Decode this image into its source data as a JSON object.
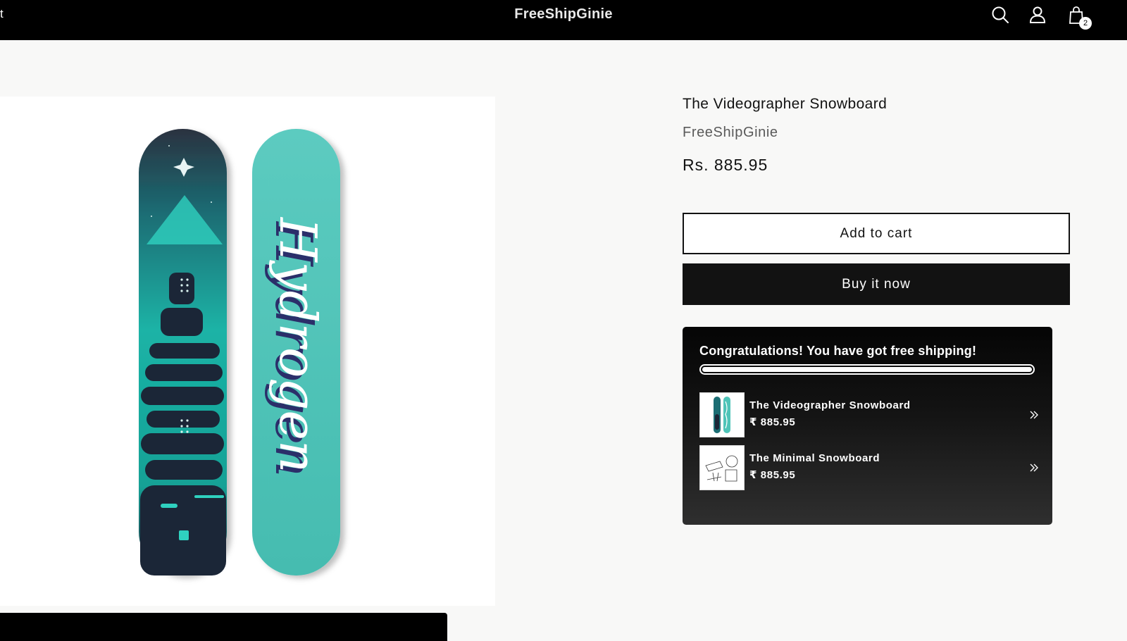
{
  "header": {
    "left_text": "t",
    "brand": "FreeShipGinie",
    "icons": [
      "search-icon",
      "account-icon",
      "cart-icon"
    ],
    "cart_count": "2"
  },
  "product": {
    "title": "The Videographer Snowboard",
    "vendor": "FreeShipGinie",
    "price": "Rs. 885.95",
    "add_to_cart_label": "Add to cart",
    "buy_now_label": "Buy it now",
    "image_text": "Hydrogen"
  },
  "free_shipping": {
    "message": "Congratulations! You have got free shipping!",
    "progress": 1.0,
    "items": [
      {
        "name": "The Videographer Snowboard",
        "price": "₹ 885.95"
      },
      {
        "name": "The Minimal Snowboard",
        "price": "₹ 885.95"
      }
    ]
  },
  "colors": {
    "header_bg": "#000000",
    "board_teal": "#4fc4b8",
    "board_dark": "#1b2637",
    "button_dark": "#121212"
  }
}
